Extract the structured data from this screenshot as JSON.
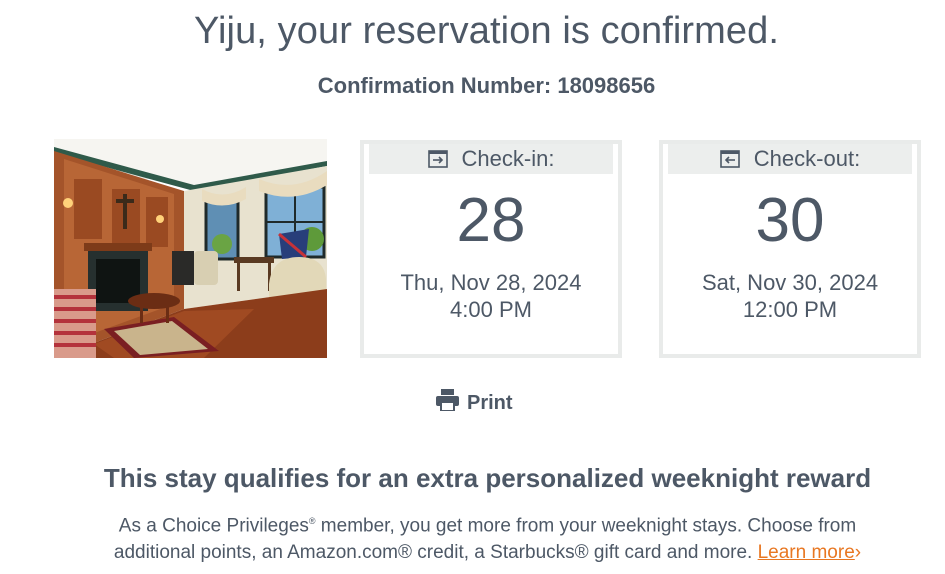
{
  "header": {
    "headline": "Yiju, your reservation is confirmed.",
    "confirmation_label": "Confirmation Number: 18098656"
  },
  "checkin": {
    "label": "Check-in:",
    "day": "28",
    "date": "Thu, Nov 28, 2024",
    "time": "4:00 PM",
    "icon": "arrow-into-box-icon"
  },
  "checkout": {
    "label": "Check-out:",
    "day": "30",
    "date": "Sat, Nov 30, 2024",
    "time": "12:00 PM",
    "icon": "arrow-out-of-box-icon"
  },
  "actions": {
    "print_label": "Print",
    "print_icon": "printer-icon"
  },
  "reward": {
    "title": "This stay qualifies for an extra personalized weeknight reward",
    "body_part1": "As a Choice Privileges",
    "body_reg": "®",
    "body_part2": " member, you get more from your weeknight stays. Choose from additional points, an Amazon.com® credit, a Starbucks® gift card and more. ",
    "learn_more": "Learn more",
    "learn_more_arrow": "›"
  },
  "colors": {
    "text": "#4d5866",
    "accent_link": "#e87722",
    "card_border": "#e9ebea",
    "card_header_bg": "#eceeed"
  }
}
